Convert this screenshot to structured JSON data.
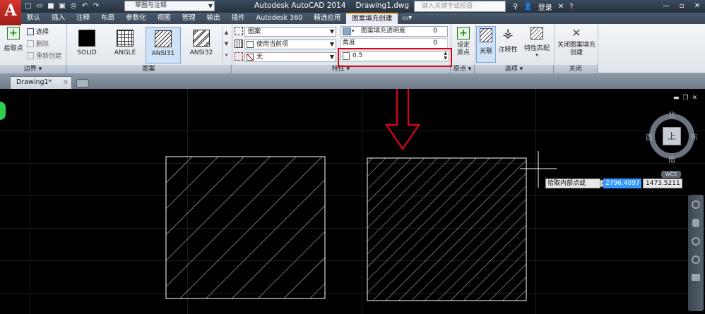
{
  "app": {
    "logo": "A",
    "title": "Autodesk AutoCAD 2014",
    "document": "Drawing1.dwg",
    "workspace": "草图与注释",
    "search_placeholder": "键入关键字或短语",
    "login": "登录"
  },
  "tabs": [
    "默认",
    "插入",
    "注释",
    "布局",
    "参数化",
    "视图",
    "管理",
    "输出",
    "插件",
    "Autodesk 360",
    "精选应用",
    "图案填充创建"
  ],
  "ribbon": {
    "boundary": {
      "pick_points": "拾取点",
      "select": "选择",
      "remove": "删除",
      "recreate": "重新创建",
      "panel_title": "边界"
    },
    "patterns": {
      "items": [
        "SOLID",
        "ANGLE",
        "ANSI31",
        "ANSI32"
      ],
      "selected": "ANSI31",
      "panel_title": "图案"
    },
    "properties": {
      "hatch_type": "图案",
      "hatch_color": "使用当前项",
      "background": "无",
      "transparency_label": "图案填充透明度",
      "transparency_value": "0",
      "angle_label": "角度",
      "angle_value": "0",
      "scale_value": "0.5",
      "panel_title": "特性"
    },
    "origin": {
      "set_origin": "设定原点",
      "panel_title": "原点"
    },
    "options": {
      "associative": "关联",
      "annotative": "注释性",
      "match_properties": "特性匹配",
      "panel_title": "选项"
    },
    "close": {
      "label": "关闭图案填充创建",
      "panel_title": "关闭"
    }
  },
  "doc_tab": "Drawing1*",
  "viewcube": {
    "north": "北",
    "south": "南",
    "east": "东",
    "west": "西",
    "top": "上",
    "wcs": "WCS"
  },
  "command": {
    "prompt": "拾取内部点或",
    "x": "2796.4097",
    "y": "1473.5211"
  },
  "colors": {
    "accent_highlight": "#e0001a",
    "selection_blue": "#3399ff"
  }
}
